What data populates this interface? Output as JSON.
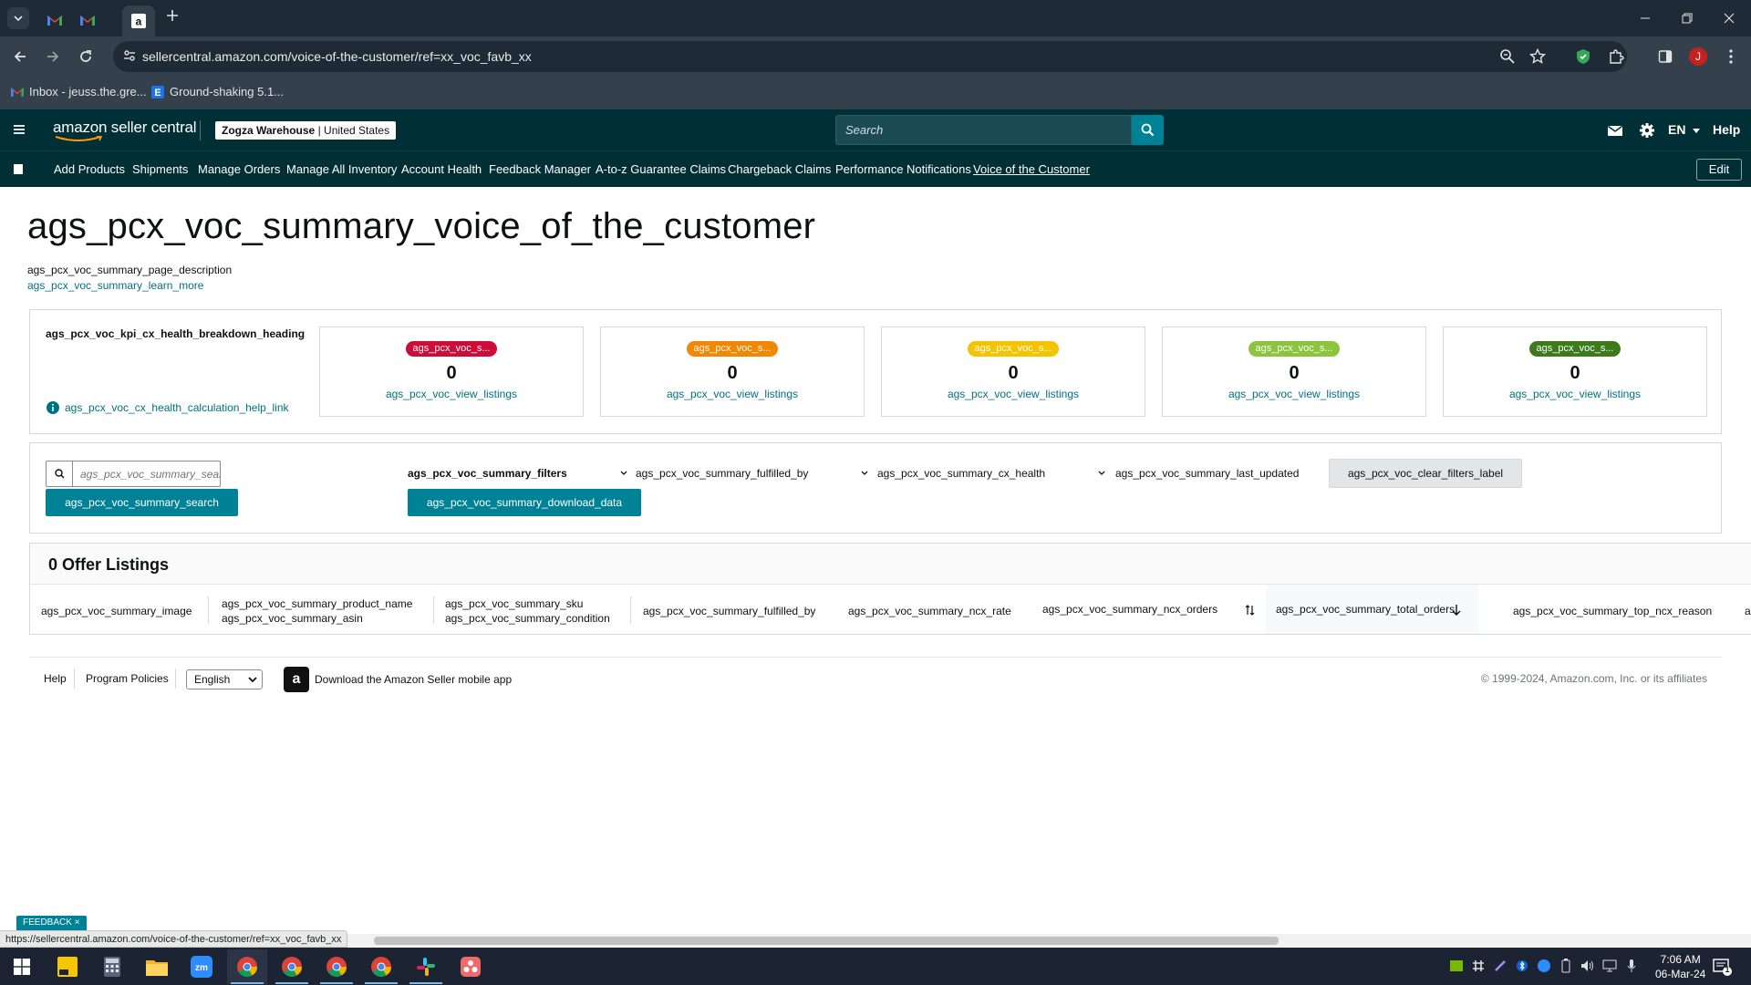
{
  "browser": {
    "url": "sellercentral.amazon.com/voice-of-the-customer/ref=xx_voc_favb_xx",
    "profile_initial": "J",
    "bookmarks": [
      {
        "label": "Inbox - jeuss.the.gre...",
        "icon": "gmail-icon"
      },
      {
        "label": "Ground-shaking 5.1...",
        "icon": "e-site-icon"
      }
    ]
  },
  "header": {
    "logo_text": "amazon seller central",
    "store_name": "Zogza Warehouse",
    "store_region": "United States",
    "search_placeholder": "Search",
    "language": "EN",
    "help": "Help"
  },
  "nav": {
    "items": [
      "Add Products",
      "Shipments",
      "Manage Orders",
      "Manage All Inventory",
      "Account Health",
      "Feedback Manager",
      "A-to-z Guarantee Claims",
      "Chargeback Claims",
      "Performance Notifications",
      "Voice of the Customer"
    ],
    "edit": "Edit"
  },
  "page": {
    "title": "ags_pcx_voc_summary_voice_of_the_customer",
    "description": "ags_pcx_voc_summary_page_description",
    "learn_more": "ags_pcx_voc_summary_learn_more"
  },
  "kpi": {
    "heading": "ags_pcx_voc_kpi_cx_health_breakdown_heading",
    "help_link": "ags_pcx_voc_cx_health_calculation_help_link",
    "cards": [
      {
        "pill": "ags_pcx_voc_s...",
        "value": "0",
        "link": "ags_pcx_voc_view_listings",
        "color": "#cc0c39"
      },
      {
        "pill": "ags_pcx_voc_s...",
        "value": "0",
        "link": "ags_pcx_voc_view_listings",
        "color": "#f08804"
      },
      {
        "pill": "ags_pcx_voc_s...",
        "value": "0",
        "link": "ags_pcx_voc_view_listings",
        "color": "#f5c400"
      },
      {
        "pill": "ags_pcx_voc_s...",
        "value": "0",
        "link": "ags_pcx_voc_view_listings",
        "color": "#8cc43d"
      },
      {
        "pill": "ags_pcx_voc_s...",
        "value": "0",
        "link": "ags_pcx_voc_view_listings",
        "color": "#3d7a1b"
      }
    ]
  },
  "filters": {
    "search_placeholder": "ags_pcx_voc_summary_search",
    "search_button": "ags_pcx_voc_summary_search",
    "filters_label": "ags_pcx_voc_summary_filters",
    "download_button": "ags_pcx_voc_summary_download_data",
    "fulfilled_by": "ags_pcx_voc_summary_fulfilled_by",
    "cx_health": "ags_pcx_voc_summary_cx_health",
    "last_updated": "ags_pcx_voc_summary_last_updated",
    "clear_filters": "ags_pcx_voc_clear_filters_label"
  },
  "listings": {
    "count_label": "0 Offer Listings",
    "columns": {
      "image": "ags_pcx_voc_summary_image",
      "product_name": "ags_pcx_voc_summary_product_name",
      "asin": "ags_pcx_voc_summary_asin",
      "sku": "ags_pcx_voc_summary_sku",
      "condition": "ags_pcx_voc_summary_condition",
      "fulfilled_by": "ags_pcx_voc_summary_fulfilled_by",
      "ncx_rate": "ags_pcx_voc_summary_ncx_rate",
      "ncx_orders": "ags_pcx_voc_summary_ncx_orders",
      "total_orders": "ags_pcx_voc_summary_total_orders",
      "top_ncx_reason": "ags_pcx_voc_summary_top_ncx_reason",
      "overflow": "a"
    }
  },
  "footer": {
    "help": "Help",
    "program_policies": "Program Policies",
    "language": "English",
    "mobile_app": "Download the Amazon Seller mobile app",
    "copyright": "© 1999-2024, Amazon.com, Inc. or its affiliates",
    "feedback": "FEEDBACK ×",
    "status_url": "https://sellercentral.amazon.com/voice-of-the-customer/ref=xx_voc_favb_xx"
  },
  "taskbar": {
    "time": "7:06 AM",
    "date": "06-Mar-24",
    "notification_count": "1"
  }
}
